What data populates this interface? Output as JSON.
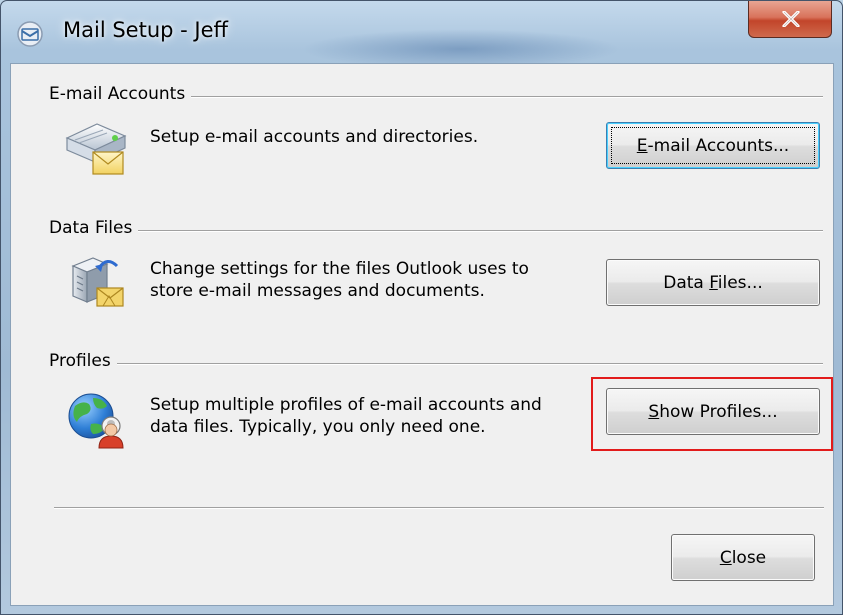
{
  "window": {
    "title": "Mail Setup - Jeff"
  },
  "email_accounts": {
    "group_label": "E-mail Accounts",
    "description": "Setup e-mail accounts and directories.",
    "button_prefix": "",
    "button_accel": "E",
    "button_suffix": "-mail Accounts..."
  },
  "data_files": {
    "group_label": "Data Files",
    "description_line1": "Change settings for the files Outlook uses to",
    "description_line2": "store e-mail messages and documents.",
    "button_prefix": "Data ",
    "button_accel": "F",
    "button_suffix": "iles..."
  },
  "profiles": {
    "group_label": "Profiles",
    "description_line1": "Setup multiple profiles of e-mail accounts and",
    "description_line2": "data files. Typically, you only need one.",
    "button_prefix": "",
    "button_accel": "S",
    "button_suffix": "how Profiles..."
  },
  "footer": {
    "close_prefix": "",
    "close_accel": "C",
    "close_suffix": "lose"
  },
  "colors": {
    "highlight": "#e21b1b",
    "close_button": "#c2452a",
    "client_background": "#f0f0f0"
  },
  "icons": [
    "app-mail-icon",
    "close-x-icon",
    "email-accounts-icon",
    "data-files-icon",
    "profiles-icon"
  ]
}
